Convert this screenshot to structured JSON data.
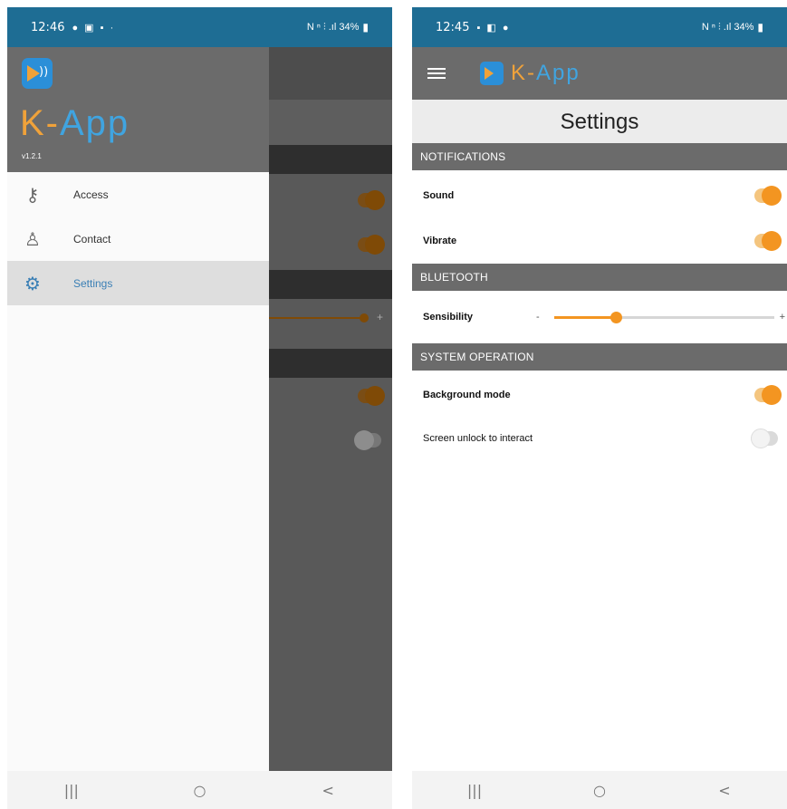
{
  "left": {
    "status": {
      "time": "12:46",
      "icons": "● ▣ ▪ ·",
      "sys": "N ⁿ ⫶ .ıl 34%",
      "battery": "▮"
    },
    "drawer": {
      "logo_k": "K-",
      "logo_app": "App",
      "version": "v1.2.1",
      "items": [
        {
          "label": "Access",
          "icon": "key-icon"
        },
        {
          "label": "Contact",
          "icon": "person-icon"
        },
        {
          "label": "Settings",
          "icon": "gears-icon"
        }
      ],
      "active_index": 2
    },
    "background_plus": "+"
  },
  "right": {
    "status": {
      "time": "12:45",
      "icons": "▪ ◧ ●",
      "sys": "N ⁿ ⫶ .ıl 34%",
      "battery": "▮"
    },
    "brand_k": "K-",
    "brand_app": "App",
    "title": "Settings",
    "sections": {
      "notifications": "NOTIFICATIONS",
      "bluetooth": "BLUETOOTH",
      "system": "SYSTEM OPERATION"
    },
    "rows": {
      "sound": {
        "label": "Sound",
        "on": true
      },
      "vibrate": {
        "label": "Vibrate",
        "on": true
      },
      "sensibility": {
        "label": "Sensibility",
        "minus": "-",
        "plus": "+",
        "value": 0.28
      },
      "background": {
        "label": "Background mode",
        "on": true
      },
      "screen_unlock": {
        "label": "Screen unlock to interact",
        "on": false
      }
    }
  },
  "navbar": {
    "recents": "|||",
    "home": "○",
    "back": "<"
  },
  "colors": {
    "accent": "#f39521",
    "statusbar": "#1e6d94",
    "appbar": "#6b6b6b",
    "link": "#3a7fb5"
  }
}
